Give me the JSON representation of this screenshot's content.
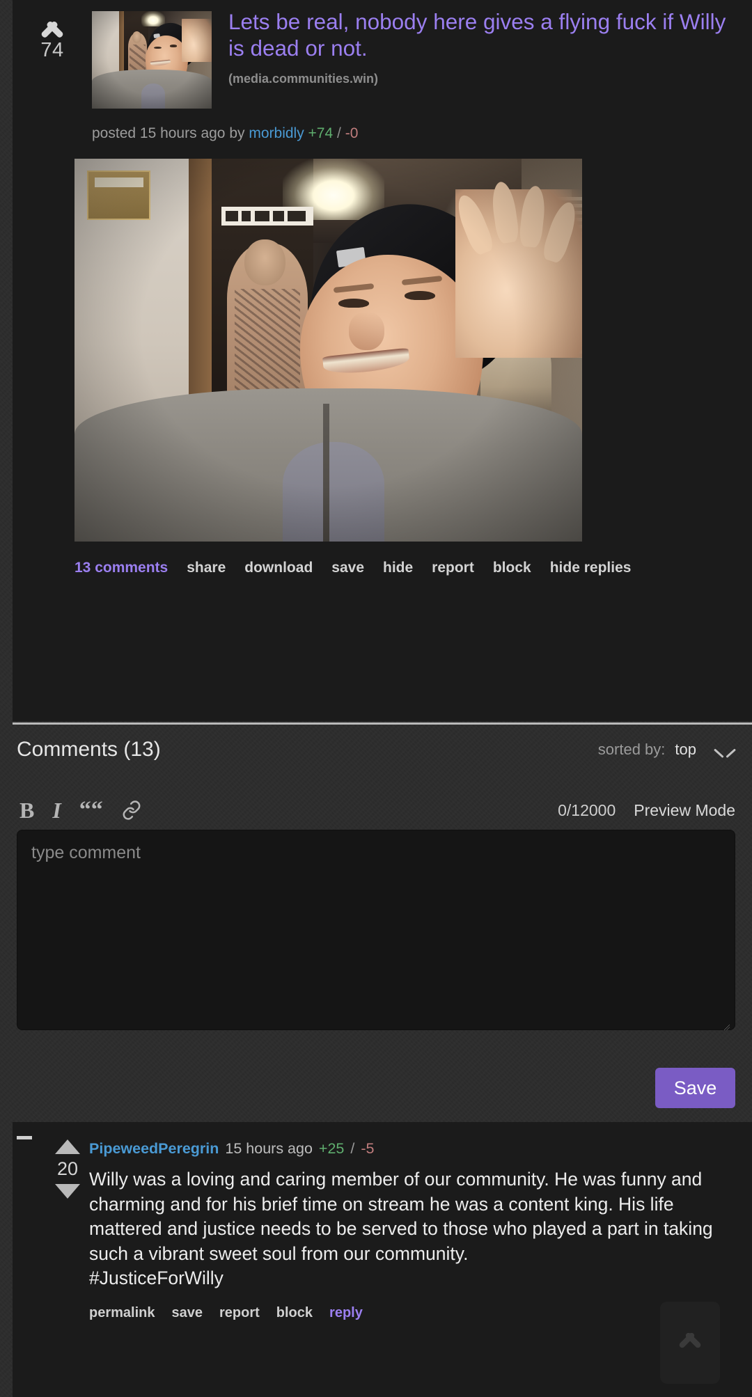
{
  "post": {
    "score": "74",
    "upvote_icon": "chevron-up-icon",
    "title": "Lets be real, nobody here gives a flying fuck if Willy is dead or not.",
    "domain": "(media.communities.win)",
    "meta_posted": "posted 15 hours ago by",
    "meta_author": "morbidly",
    "meta_upvotes": "+74",
    "meta_slash": "/",
    "meta_downvotes": "-0",
    "links": [
      {
        "label": "13 comments",
        "highlight": true
      },
      {
        "label": "share",
        "highlight": false
      },
      {
        "label": "download",
        "highlight": false
      },
      {
        "label": "save",
        "highlight": false
      },
      {
        "label": "hide",
        "highlight": false
      },
      {
        "label": "report",
        "highlight": false
      },
      {
        "label": "block",
        "highlight": false
      },
      {
        "label": "hide replies",
        "highlight": false
      }
    ]
  },
  "comments_section": {
    "title": "Comments (13)",
    "sort_label": "sorted by:",
    "sort_value": "top",
    "sort_chevron_icon": "chevron-down-icon"
  },
  "editor": {
    "bold_icon": "bold-icon",
    "bold_label": "B",
    "italic_icon": "italic-icon",
    "italic_label": "I",
    "quote_icon": "quote-icon",
    "quote_label": "“",
    "link_icon": "link-icon",
    "char_count": "0/12000",
    "preview_label": "Preview Mode",
    "placeholder": "type comment",
    "value": "",
    "save_label": "Save"
  },
  "comment": {
    "collapse_icon": "collapse-minus-icon",
    "upvote_icon": "triangle-up-icon",
    "downvote_icon": "triangle-down-icon",
    "score": "20",
    "author": "PipeweedPeregrin",
    "time": "15 hours ago",
    "upvotes": "+25",
    "slash": "/",
    "downvotes": "-5",
    "body": "Willy was a loving and caring member of our community. He was funny and charming and for his brief time on stream he was a content king. His life mattered and justice needs to be served to those who played a part in taking such a vibrant sweet soul from our community. #JusticeForWilly",
    "links": [
      {
        "label": "permalink",
        "highlight": false
      },
      {
        "label": "save",
        "highlight": false
      },
      {
        "label": "report",
        "highlight": false
      },
      {
        "label": "block",
        "highlight": false
      },
      {
        "label": "reply",
        "highlight": true
      }
    ]
  },
  "floating": {
    "back_to_top_icon": "chevron-up-icon"
  },
  "colors": {
    "accent_purple": "#9b7ff0",
    "save_button": "#7a5cc4",
    "user_link": "#4a9ad4",
    "upvote_green": "#5fae6e",
    "downvote_red": "#c07d7d",
    "card_bg": "#1b1b1b",
    "page_bg": "#2c2c2c"
  }
}
